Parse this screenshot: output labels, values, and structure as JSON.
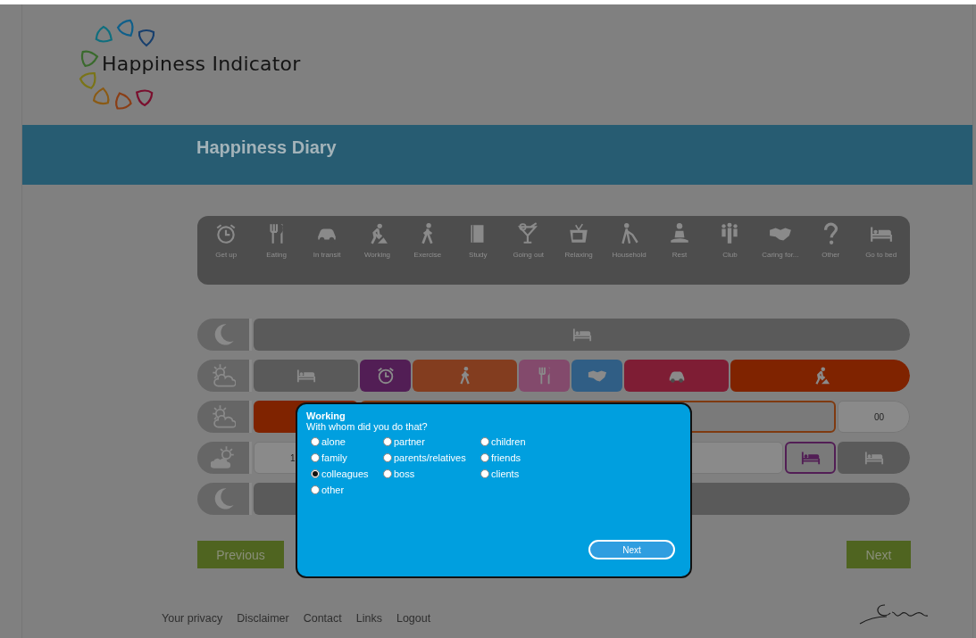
{
  "logo": {
    "text": "Happiness Indicator"
  },
  "banner": {
    "title": "Happiness Diary"
  },
  "activities": [
    {
      "label": "Get up"
    },
    {
      "label": "Eating"
    },
    {
      "label": "In transit"
    },
    {
      "label": "Working"
    },
    {
      "label": "Exercise"
    },
    {
      "label": "Study"
    },
    {
      "label": "Going out"
    },
    {
      "label": "Relaxing"
    },
    {
      "label": "Household"
    },
    {
      "label": "Rest"
    },
    {
      "label": "Club"
    },
    {
      "label": "Caring for..."
    },
    {
      "label": "Other"
    },
    {
      "label": "Go to bed"
    }
  ],
  "timeline": [
    {
      "segments": [
        {
          "kind": "filled",
          "color": "#5a5a5a"
        }
      ]
    },
    {
      "segments": [
        {
          "kind": "filled",
          "color": "#5a5a5a"
        },
        {
          "kind": "filled",
          "color": "#521e55"
        },
        {
          "kind": "filled",
          "color": "#833d1f"
        },
        {
          "kind": "filled",
          "color": "#834a6c"
        },
        {
          "kind": "filled",
          "color": "#305e85"
        },
        {
          "kind": "filled",
          "color": "#7e1d34"
        },
        {
          "kind": "filled",
          "color": "#7f2300"
        }
      ]
    },
    {
      "segments": [
        {
          "kind": "filled",
          "color": "#7f2300"
        },
        {
          "kind": "outline",
          "color": "#7f3a10"
        },
        {
          "kind": "empty",
          "text": "00"
        }
      ]
    },
    {
      "segments": [
        {
          "kind": "empty",
          "text": "1"
        },
        {
          "kind": "outline",
          "color": "#521e55"
        },
        {
          "kind": "filled",
          "color": "#5a5a5a"
        }
      ]
    },
    {
      "segments": [
        {
          "kind": "filled",
          "color": "#5a5a5a"
        }
      ]
    }
  ],
  "nav": {
    "previous": "Previous",
    "next": "Next"
  },
  "footer_links": [
    "Your privacy",
    "Disclaimer",
    "Contact",
    "Links",
    "Logout"
  ],
  "dialog": {
    "title": "Working",
    "question": "With whom did you do that?",
    "options": [
      {
        "label": "alone",
        "selected": false
      },
      {
        "label": "partner",
        "selected": false
      },
      {
        "label": "children",
        "selected": false
      },
      {
        "label": "family",
        "selected": false
      },
      {
        "label": "parents/relatives",
        "selected": false
      },
      {
        "label": "friends",
        "selected": false
      },
      {
        "label": "colleagues",
        "selected": true
      },
      {
        "label": "boss",
        "selected": false
      },
      {
        "label": "clients",
        "selected": false
      },
      {
        "label": "other",
        "selected": false
      }
    ],
    "button": "Next"
  }
}
